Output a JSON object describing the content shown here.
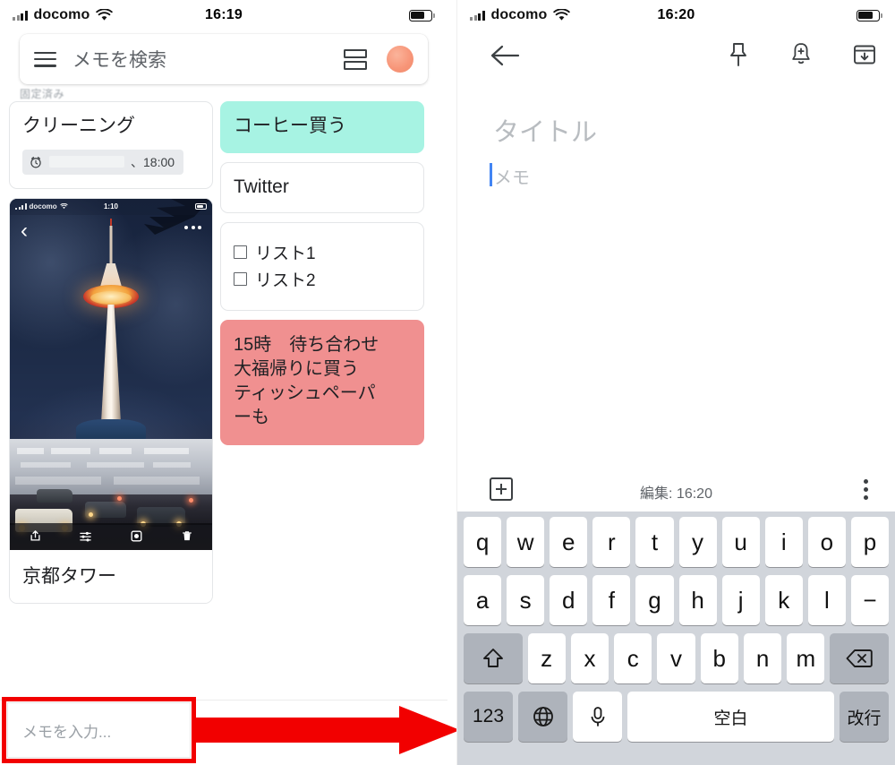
{
  "left_phone": {
    "status_bar": {
      "carrier": "docomo",
      "time": "16:19",
      "wifi_icon": "wifi-icon",
      "signal_icon": "signal-bars-icon",
      "battery_icon": "battery-icon"
    },
    "search": {
      "placeholder": "メモを検索",
      "menu_icon": "hamburger-menu-icon",
      "view_toggle_icon": "list-view-icon",
      "avatar_icon": "account-avatar",
      "avatar_color": "#f79578"
    },
    "section_label": "固定済み",
    "notes_column_a": [
      {
        "type": "reminder",
        "title": "クリーニング",
        "chip_icon": "alarm-clock-icon",
        "chip_date_redacted": true,
        "chip_time": "、18:00",
        "bg": "#ffffff"
      },
      {
        "type": "photo",
        "caption": "京都タワー",
        "photo_status_bar": {
          "carrier": "docomo",
          "time": "1:10"
        },
        "photo_back_icon": "chevron-left-icon",
        "photo_more_icon": "more-options-icon",
        "photo_toolbar_icons": [
          "share-icon",
          "adjust-sliders-icon",
          "markup-icon",
          "trash-icon"
        ],
        "bg": "#ffffff"
      }
    ],
    "notes_column_b": [
      {
        "type": "text",
        "title": "コーヒー買う",
        "bg": "#a7f3e3"
      },
      {
        "type": "text",
        "title": "Twitter",
        "bg": "#ffffff"
      },
      {
        "type": "checklist",
        "items": [
          "リスト1",
          "リスト2"
        ],
        "bg": "#ffffff"
      },
      {
        "type": "text",
        "title": "15時　待ち合わせ\n大福帰りに買う\nティッシュペーパ\nーも",
        "bg": "#f09090"
      }
    ],
    "bottom_input": {
      "placeholder": "メモを入力...",
      "highlight_color": "#f20000"
    },
    "annotation": {
      "arrow_icon": "red-right-arrow",
      "arrow_color": "#f20000"
    }
  },
  "right_phone": {
    "status_bar": {
      "carrier": "docomo",
      "time": "16:20",
      "wifi_icon": "wifi-icon",
      "signal_icon": "signal-bars-icon",
      "battery_icon": "battery-icon"
    },
    "toolbar": {
      "back_icon": "back-arrow-icon",
      "pin_icon": "pin-icon",
      "reminder_icon": "add-reminder-bell-icon",
      "archive_icon": "archive-icon"
    },
    "editor": {
      "title_placeholder": "タイトル",
      "body_placeholder": "メモ",
      "caret_color": "#4285f4"
    },
    "bottom_toolbar": {
      "add_icon": "add-box-icon",
      "edited_label": "編集: 16:20",
      "more_icon": "more-vertical-icon"
    },
    "keyboard": {
      "row1": [
        "q",
        "w",
        "e",
        "r",
        "t",
        "y",
        "u",
        "i",
        "o",
        "p"
      ],
      "row2": [
        "a",
        "s",
        "d",
        "f",
        "g",
        "h",
        "j",
        "k",
        "l",
        "−"
      ],
      "row3": [
        "z",
        "x",
        "c",
        "v",
        "b",
        "n",
        "m"
      ],
      "shift_icon": "shift-arrow-icon",
      "backspace_icon": "backspace-icon",
      "numbers_key": "123",
      "globe_icon": "globe-language-icon",
      "mic_icon": "microphone-icon",
      "space_key": "空白",
      "return_key": "改行"
    }
  }
}
